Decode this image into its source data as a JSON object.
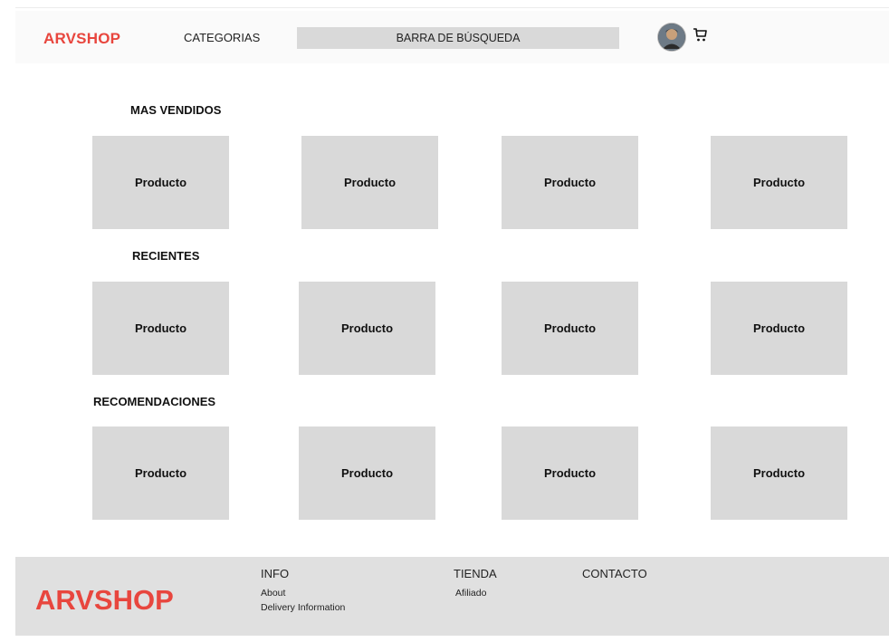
{
  "header": {
    "brand": "ARVSHOP",
    "categories_label": "CATEGORIAS",
    "search_placeholder": "BARRA DE BÚSQUEDA",
    "avatar_icon": "user-avatar",
    "cart_icon": "cart-icon"
  },
  "sections": [
    {
      "title": "MAS VENDIDOS",
      "products": [
        "Producto",
        "Producto",
        "Producto",
        "Producto"
      ]
    },
    {
      "title": "RECIENTES",
      "products": [
        "Producto",
        "Producto",
        "Producto",
        "Producto"
      ]
    },
    {
      "title": "RECOMENDACIONES",
      "products": [
        "Producto",
        "Producto",
        "Producto",
        "Producto"
      ]
    }
  ],
  "footer": {
    "brand": "ARVSHOP",
    "info": {
      "heading": "INFO",
      "links": [
        "About",
        "Delivery Information"
      ]
    },
    "tienda": {
      "heading": "TIENDA",
      "links": [
        "Afiliado"
      ]
    },
    "contacto": {
      "heading": "CONTACTO"
    }
  },
  "colors": {
    "brand": "#e8463e",
    "placeholder_gray": "#d9d9d9",
    "footer_bg": "#e0e0e0"
  }
}
